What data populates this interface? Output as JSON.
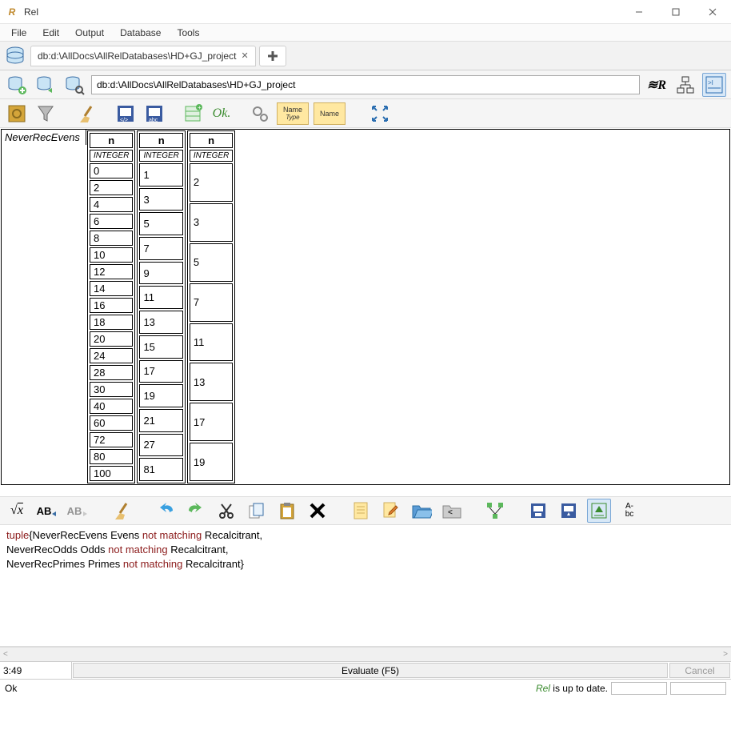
{
  "window": {
    "title": "Rel"
  },
  "menu": [
    "File",
    "Edit",
    "Output",
    "Database",
    "Tools"
  ],
  "tab": {
    "label": "db:d:\\AllDocs\\AllRelDatabases\\HD+GJ_project"
  },
  "path_input": "db:d:\\AllDocs\\AllRelDatabases\\HD+GJ_project",
  "ok_label": "Ok.",
  "name_btn1": {
    "top": "Name",
    "sub": "Type"
  },
  "name_btn2": {
    "top": "Name",
    "sub": ""
  },
  "result": {
    "label": "NeverRecEvens",
    "columns": [
      {
        "header": "n",
        "type": "INTEGER",
        "values": [
          "0",
          "2",
          "4",
          "6",
          "8",
          "10",
          "12",
          "14",
          "16",
          "18",
          "20",
          "24",
          "28",
          "30",
          "40",
          "60",
          "72",
          "80",
          "100"
        ]
      },
      {
        "header": "n",
        "type": "INTEGER",
        "values": [
          "1",
          "3",
          "5",
          "7",
          "9",
          "11",
          "13",
          "15",
          "17",
          "19",
          "21",
          "27",
          "81"
        ]
      },
      {
        "header": "n",
        "type": "INTEGER",
        "values": [
          "2",
          "3",
          "5",
          "7",
          "11",
          "13",
          "17",
          "19"
        ]
      }
    ]
  },
  "editor": {
    "line1_a": "tuple",
    "line1_b": "{NeverRecEvens Evens ",
    "line1_c": "not matching",
    "line1_d": " Recalcitrant,",
    "line2_a": "NeverRecOdds Odds ",
    "line2_b": "not matching",
    "line2_c": " Recalcitrant,",
    "line3_a": "NeverRecPrimes Primes ",
    "line3_b": "not matching",
    "line3_c": " Recalcitrant}"
  },
  "cursor_pos": "3:49",
  "eval_label": "Evaluate (F5)",
  "cancel_label": "Cancel",
  "status_ok": "Ok",
  "status_rel_italic": "Rel",
  "status_rel_rest": " is up to date."
}
